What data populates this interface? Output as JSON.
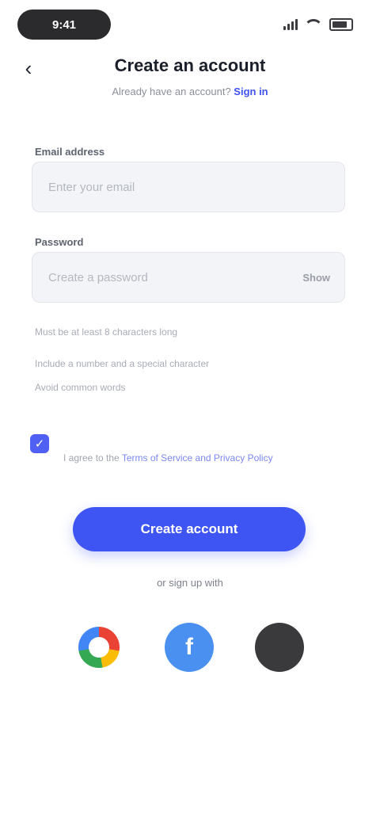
{
  "status_bar": {
    "time": "9:41"
  },
  "header": {
    "back_icon": "arrow-left-icon",
    "title": "Create an account",
    "subtitle_text": "Already have an account?",
    "subtitle_link": "Sign in"
  },
  "form": {
    "email": {
      "label": "Email address",
      "placeholder": "Enter your email"
    },
    "password": {
      "label": "Password",
      "placeholder": "Create a password",
      "toggle_label": "Show"
    },
    "hints": [
      "Must be at least 8 characters long",
      "Include a number and a special character",
      "Avoid common words"
    ]
  },
  "terms": {
    "checked": true,
    "text": "I agree to the",
    "link": "Terms of Service and Privacy Policy"
  },
  "primary_button": {
    "label": "Create account",
    "color": "#3f55f3"
  },
  "divider": {
    "text": "or sign up with"
  },
  "social": {
    "google": {
      "icon": "google-icon"
    },
    "facebook": {
      "icon": "facebook-icon",
      "glyph": "f",
      "color": "#4a90f0"
    },
    "apple": {
      "icon": "apple-icon",
      "glyph": "",
      "color": "#3a3a3c"
    }
  }
}
